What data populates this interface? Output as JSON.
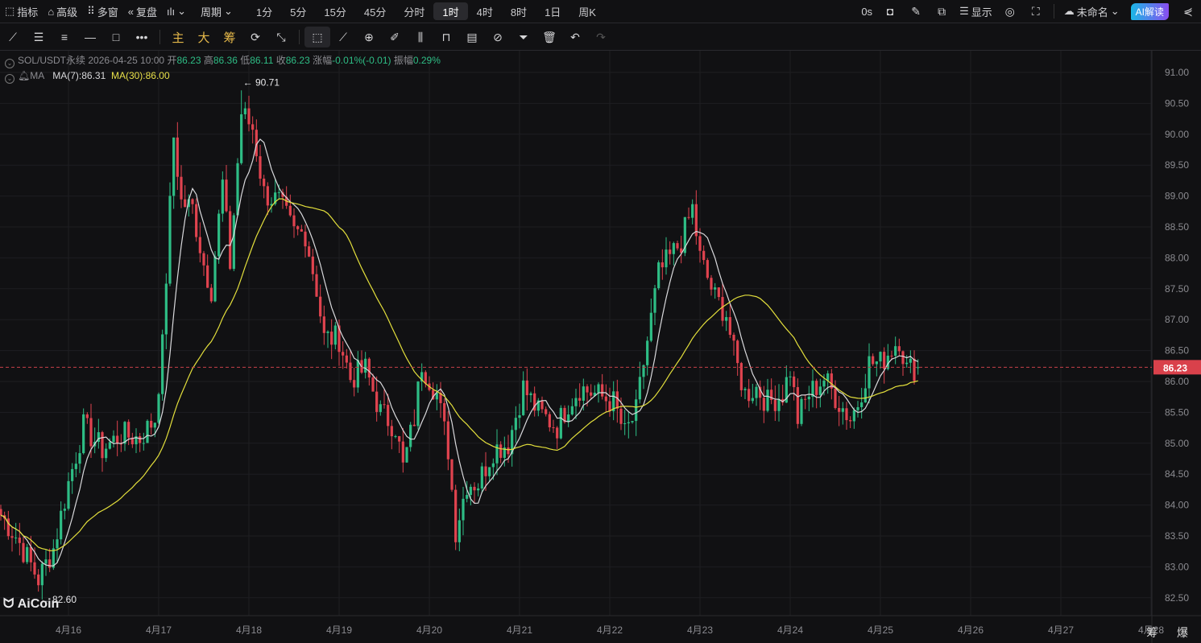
{
  "toolbar": {
    "indicators": "指标",
    "advanced": "高级",
    "multi_window": "多窗",
    "replay": "复盘",
    "period": "周期",
    "periods": [
      "1分",
      "5分",
      "15分",
      "45分",
      "分时",
      "1时",
      "4时",
      "8时",
      "1日",
      "周K"
    ],
    "active_period": "1时",
    "countdown": "0s",
    "display": "显示",
    "layout_name": "未命名",
    "ai_button": "AI解读"
  },
  "drawbar": {
    "main": "主",
    "big": "大",
    "chips": "筹"
  },
  "info": {
    "symbol": "SOL/USDT永续",
    "time": "2026-04-25 10:00",
    "open_label": "开",
    "open": "86.23",
    "high_label": "高",
    "high": "86.36",
    "low_label": "低",
    "low": "86.11",
    "close_label": "收",
    "close": "86.23",
    "change_label": "涨幅",
    "change": "-0.01%(-0.01)",
    "amp_label": "振幅",
    "amp": "0.29%",
    "ma_label": "MA",
    "ma7": "MA(7):86.31",
    "ma30": "MA(30):86.00"
  },
  "logo": "AiCoin",
  "bottom_right": "筹 爆",
  "colors": {
    "up": "#2ebd85",
    "down": "#e0434f",
    "ma7": "#d9d9dc",
    "ma30": "#e3df3c",
    "bg": "#111113"
  },
  "chart_data": {
    "type": "candlestick",
    "symbol": "SOL/USDT永续",
    "interval": "1h",
    "ylim": [
      82.3,
      91.2
    ],
    "yticks": [
      "91.00",
      "90.50",
      "90.00",
      "89.50",
      "89.00",
      "88.50",
      "88.00",
      "87.50",
      "87.00",
      "86.50",
      "86.00",
      "85.50",
      "85.00",
      "84.50",
      "84.00",
      "83.50",
      "83.00",
      "82.50"
    ],
    "xticks": [
      "4月16",
      "4月17",
      "4月18",
      "4月19",
      "4月20",
      "4月21",
      "4月22",
      "4月23",
      "4月24",
      "4月25",
      "4月26",
      "4月27",
      "4月28"
    ],
    "first_candle_hour_before_4月16": 18,
    "close_keypoints_hour_price": [
      [
        0,
        83.84
      ],
      [
        4,
        83.5
      ],
      [
        10,
        82.8
      ],
      [
        14,
        83.3
      ],
      [
        18,
        84.36
      ],
      [
        22,
        85.27
      ],
      [
        27,
        84.9
      ],
      [
        32,
        85.14
      ],
      [
        37,
        85.08
      ],
      [
        41,
        85.4
      ],
      [
        43,
        86.57
      ],
      [
        46,
        89.96
      ],
      [
        48,
        88.9
      ],
      [
        51,
        88.8
      ],
      [
        54,
        87.9
      ],
      [
        56,
        87.5
      ],
      [
        59,
        89.2
      ],
      [
        61,
        87.9
      ],
      [
        64,
        90.35
      ],
      [
        67,
        90.1
      ],
      [
        70,
        89.05
      ],
      [
        74,
        88.9
      ],
      [
        78,
        88.4
      ],
      [
        81,
        88.4
      ],
      [
        84,
        87.5
      ],
      [
        86,
        86.7
      ],
      [
        90,
        86.7
      ],
      [
        93,
        86.05
      ],
      [
        97,
        86.2
      ],
      [
        101,
        85.5
      ],
      [
        105,
        85.27
      ],
      [
        107,
        84.6
      ],
      [
        110,
        85.4
      ],
      [
        112,
        86.3
      ],
      [
        116,
        85.8
      ],
      [
        119,
        84.9
      ],
      [
        121,
        83.6
      ],
      [
        124,
        84.36
      ],
      [
        127,
        84.36
      ],
      [
        131,
        84.9
      ],
      [
        135,
        85.0
      ],
      [
        139,
        85.9
      ],
      [
        143,
        85.5
      ],
      [
        148,
        85.27
      ],
      [
        151,
        85.66
      ],
      [
        154,
        85.9
      ],
      [
        158,
        85.8
      ],
      [
        163,
        85.66
      ],
      [
        166,
        85.14
      ],
      [
        169,
        85.5
      ],
      [
        171,
        86.3
      ],
      [
        175,
        87.74
      ],
      [
        178,
        88.0
      ],
      [
        181,
        88.27
      ],
      [
        184,
        88.8
      ],
      [
        186,
        88.0
      ],
      [
        190,
        87.35
      ],
      [
        193,
        87.1
      ],
      [
        195,
        86.44
      ],
      [
        198,
        85.8
      ],
      [
        201,
        85.9
      ],
      [
        204,
        85.66
      ],
      [
        208,
        85.8
      ],
      [
        210,
        86.2
      ],
      [
        212,
        85.4
      ],
      [
        215,
        85.8
      ],
      [
        219,
        86.05
      ],
      [
        223,
        85.66
      ],
      [
        226,
        85.4
      ],
      [
        228,
        85.66
      ],
      [
        231,
        86.3
      ],
      [
        234,
        86.3
      ],
      [
        239,
        86.7
      ],
      [
        241,
        86.2
      ],
      [
        244,
        86.23
      ]
    ],
    "last_candle": {
      "open": 86.23,
      "high": 86.36,
      "low": 86.11,
      "close": 86.23
    },
    "max_marker": {
      "hour": 64,
      "value": 90.71,
      "label": "← 90.71"
    },
    "min_marker": {
      "hour": 10,
      "value": 82.6,
      "label": "← 82.60"
    },
    "current_price": {
      "value": 86.23,
      "label": "86.23"
    },
    "series": [
      {
        "name": "MA(7)",
        "period": 7
      },
      {
        "name": "MA(30)",
        "period": 30
      }
    ]
  }
}
